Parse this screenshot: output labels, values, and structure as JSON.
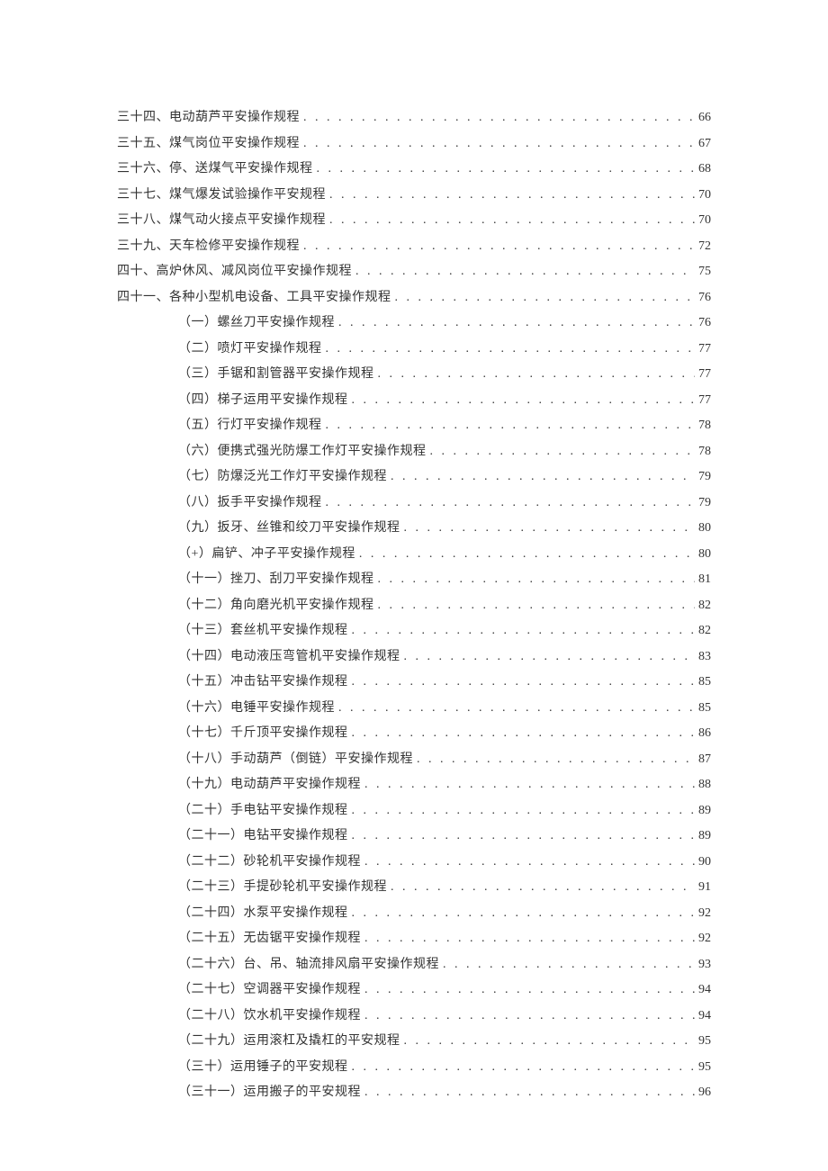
{
  "toc": {
    "entries": [
      {
        "level": 0,
        "title": "三十四、电动葫芦平安操作规程",
        "page": "66"
      },
      {
        "level": 0,
        "title": "三十五、煤气岗位平安操作规程",
        "page": "67"
      },
      {
        "level": 0,
        "title": "三十六、停、送煤气平安操作规程",
        "page": "68"
      },
      {
        "level": 0,
        "title": "三十七、煤气爆发试验操作平安规程",
        "page": "70"
      },
      {
        "level": 0,
        "title": "三十八、煤气动火接点平安操作规程",
        "page": "70"
      },
      {
        "level": 0,
        "title": "三十九、天车检修平安操作规程",
        "page": "72"
      },
      {
        "level": 0,
        "title": "四十、高炉休风、减风岗位平安操作规程",
        "page": "75"
      },
      {
        "level": 0,
        "title": "四十一、各种小型机电设备、工具平安操作规程",
        "page": "76"
      },
      {
        "level": 1,
        "title": "（一）螺丝刀平安操作规程",
        "page": "76"
      },
      {
        "level": 1,
        "title": "（二）喷灯平安操作规程",
        "page": "77"
      },
      {
        "level": 1,
        "title": "（三）手锯和割管器平安操作规程",
        "page": "77"
      },
      {
        "level": 1,
        "title": "（四）梯子运用平安操作规程",
        "page": "77"
      },
      {
        "level": 1,
        "title": "（五）行灯平安操作规程",
        "page": "78"
      },
      {
        "level": 1,
        "title": "（六）便携式强光防爆工作灯平安操作规程",
        "page": "78"
      },
      {
        "level": 1,
        "title": "（七）防爆泛光工作灯平安操作规程",
        "page": "79"
      },
      {
        "level": 1,
        "title": "（八）扳手平安操作规程",
        "page": "79"
      },
      {
        "level": 1,
        "title": "（九）扳牙、丝锥和绞刀平安操作规程",
        "page": "80"
      },
      {
        "level": 1,
        "title": "（+）扁铲、冲子平安操作规程",
        "page": "80"
      },
      {
        "level": 1,
        "title": "（十一）挫刀、刮刀平安操作规程",
        "page": "81"
      },
      {
        "level": 1,
        "title": "（十二）角向磨光机平安操作规程",
        "page": "82"
      },
      {
        "level": 1,
        "title": "（十三）套丝机平安操作规程",
        "page": "82"
      },
      {
        "level": 1,
        "title": "（十四）电动液压弯管机平安操作规程",
        "page": "83"
      },
      {
        "level": 1,
        "title": "（十五）冲击钻平安操作规程",
        "page": "85"
      },
      {
        "level": 1,
        "title": "（十六）电锤平安操作规程",
        "page": "85"
      },
      {
        "level": 1,
        "title": "（十七）千斤顶平安操作规程",
        "page": "86"
      },
      {
        "level": 1,
        "title": "（十八）手动葫芦（倒链）平安操作规程",
        "page": "87"
      },
      {
        "level": 1,
        "title": "（十九）电动葫芦平安操作规程",
        "page": "88"
      },
      {
        "level": 1,
        "title": "（二十）手电钻平安操作规程",
        "page": "89"
      },
      {
        "level": 1,
        "title": "（二十一）电钻平安操作规程",
        "page": "89"
      },
      {
        "level": 1,
        "title": "（二十二）砂轮机平安操作规程",
        "page": "90"
      },
      {
        "level": 1,
        "title": "（二十三）手提砂轮机平安操作规程",
        "page": "91"
      },
      {
        "level": 1,
        "title": "（二十四）水泵平安操作规程",
        "page": "92"
      },
      {
        "level": 1,
        "title": "（二十五）无齿锯平安操作规程",
        "page": "92"
      },
      {
        "level": 1,
        "title": "（二十六）台、吊、轴流排风扇平安操作规程",
        "page": "93"
      },
      {
        "level": 1,
        "title": "（二十七）空调器平安操作规程",
        "page": "94"
      },
      {
        "level": 1,
        "title": "（二十八）饮水机平安操作规程",
        "page": "94"
      },
      {
        "level": 1,
        "title": "（二十九）运用滚杠及撬杠的平安规程",
        "page": "95"
      },
      {
        "level": 1,
        "title": "（三十）运用锤子的平安规程",
        "page": "95"
      },
      {
        "level": 1,
        "title": "（三十一）运用搬子的平安规程",
        "page": "96"
      }
    ]
  }
}
